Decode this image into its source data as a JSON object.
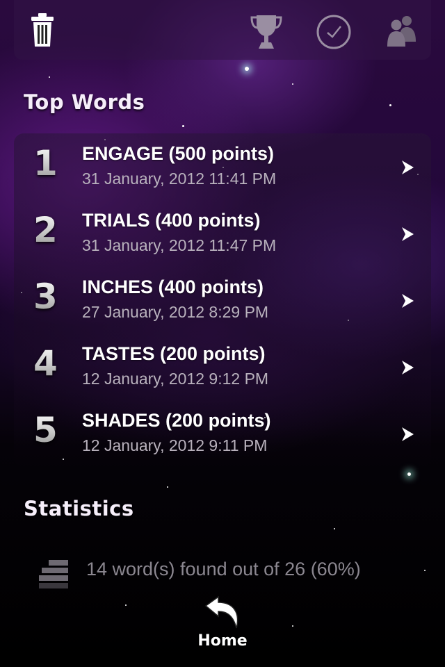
{
  "toolbar": {
    "icons": [
      "trash-icon",
      "trophy-icon",
      "clock-icon",
      "people-icon"
    ]
  },
  "top_words": {
    "title": "Top Words",
    "items": [
      {
        "rank": "1",
        "word": "ENGAGE (500 points)",
        "date": "31 January, 2012 11:41 PM"
      },
      {
        "rank": "2",
        "word": "TRIALS (400 points)",
        "date": "31 January, 2012 11:47 PM"
      },
      {
        "rank": "3",
        "word": "INCHES (400 points)",
        "date": "27 January, 2012 8:29 PM"
      },
      {
        "rank": "4",
        "word": "TASTES (200 points)",
        "date": "12 January, 2012 9:12 PM"
      },
      {
        "rank": "5",
        "word": "SHADES (200 points)",
        "date": "12 January, 2012 9:11 PM"
      }
    ]
  },
  "statistics": {
    "title": "Statistics",
    "found_text": "14 word(s) found out of 26 (60%)"
  },
  "home": {
    "label": "Home"
  },
  "colors": {
    "accent_purple": "#6a2a8e",
    "muted_text": "#b9b2bd",
    "stat_text": "#8b8790"
  }
}
